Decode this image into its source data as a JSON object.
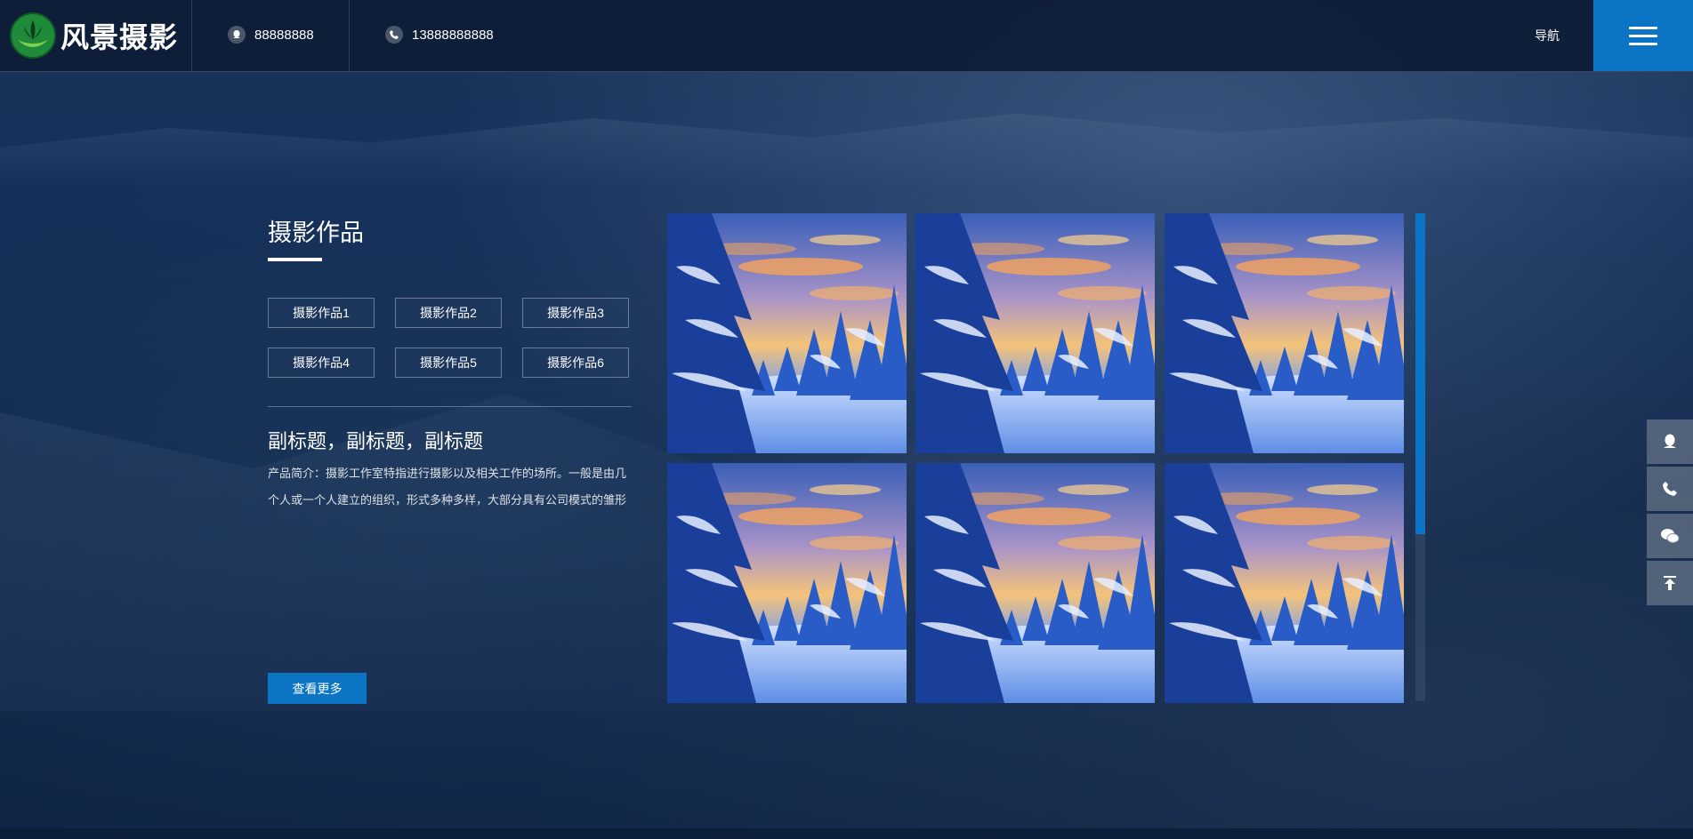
{
  "header": {
    "logo_text": "风景摄影",
    "qq": "88888888",
    "phone": "13888888888",
    "nav_label": "导航"
  },
  "section": {
    "title": "摄影作品",
    "tags": [
      "摄影作品1",
      "摄影作品2",
      "摄影作品3",
      "摄影作品4",
      "摄影作品5",
      "摄影作品6"
    ],
    "subtitle": "副标题，副标题，副标题",
    "intro": "产品简介：摄影工作室特指进行摄影以及相关工作的场所。一般是由几个人或一个人建立的组织，形式多种多样，大部分具有公司模式的雏形",
    "more_label": "查看更多"
  },
  "gallery": {
    "count": 6
  },
  "side_bar": {
    "items": [
      "qq-icon",
      "phone-icon",
      "wechat-icon",
      "back-to-top-icon"
    ]
  },
  "colors": {
    "accent": "#0b74c4",
    "background": "#0f2444"
  }
}
